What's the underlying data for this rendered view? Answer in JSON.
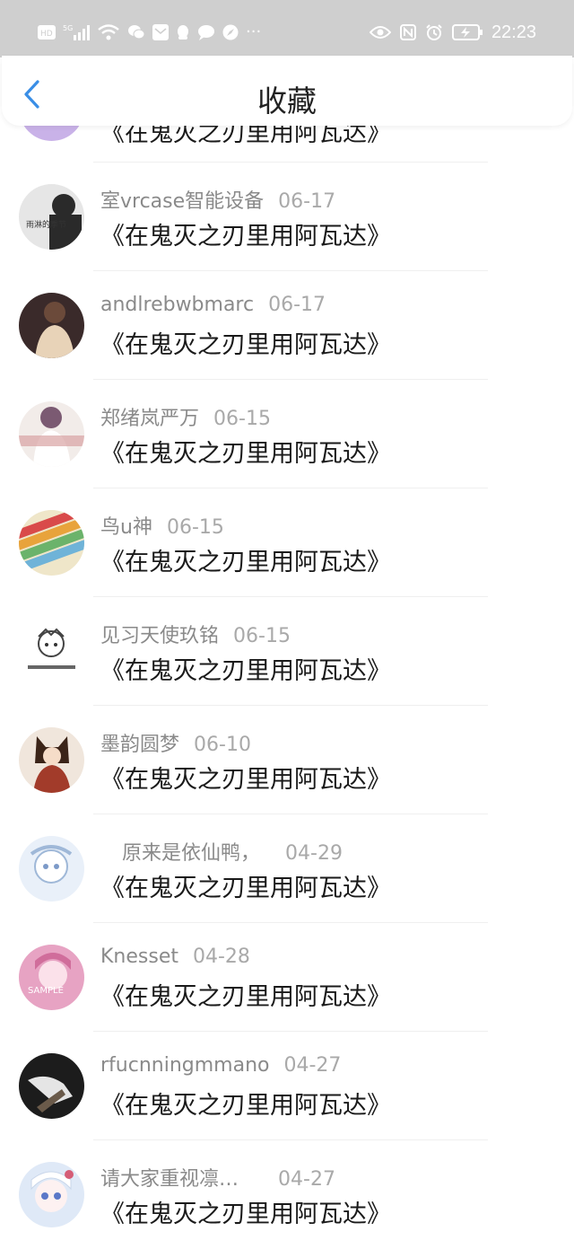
{
  "status_bar": {
    "time": "22:23",
    "icons": [
      "hd-icon",
      "signal-5g-icon",
      "wifi-icon",
      "wechat-icon",
      "mail-icon",
      "qq-icon",
      "chat-icon",
      "compass-icon",
      "more-icon",
      "eye-icon",
      "nfc-icon",
      "alarm-icon",
      "battery-charging-icon"
    ]
  },
  "header": {
    "title": "收藏",
    "back_icon": "chevron-left-icon"
  },
  "top_partial": {
    "text": "《在鬼灭之刃里用阿瓦达》",
    "avatar_color": "#c9b2e8"
  },
  "items": [
    {
      "name": "室vrcase智能设备",
      "date": "06-17",
      "text": "《在鬼灭之刃里用阿瓦达》",
      "avatar": {
        "bg": "#e6e6e6",
        "fg": "#2a2a2a"
      }
    },
    {
      "name": "andlrebwbmarc",
      "date": "06-17",
      "text": "《在鬼灭之刃里用阿瓦达》",
      "avatar": {
        "bg": "#3a2a2a",
        "fg": "#e8d3b8"
      }
    },
    {
      "name": "郑绪岚严万",
      "date": "06-15",
      "text": "《在鬼灭之刃里用阿瓦达》",
      "avatar": {
        "bg": "#f2ece9",
        "fg": "#a37d8f"
      }
    },
    {
      "name": "鸟u神",
      "date": "06-15",
      "text": "《在鬼灭之刃里用阿瓦达》",
      "avatar": {
        "bg": "#d96b4a",
        "fg": "#6fb3d8"
      }
    },
    {
      "name": "见习天使玖铭",
      "date": "06-15",
      "text": "《在鬼灭之刃里用阿瓦达》",
      "avatar": {
        "bg": "#ffffff",
        "fg": "#555555"
      }
    },
    {
      "name": "墨韵圆梦",
      "date": "06-10",
      "text": "《在鬼灭之刃里用阿瓦达》",
      "avatar": {
        "bg": "#f0e6dc",
        "fg": "#3b2418"
      }
    },
    {
      "name": "原来是依仙鸭，",
      "date": "04-29",
      "text": "《在鬼灭之刃里用阿瓦达》",
      "avatar": {
        "bg": "#e9f0f9",
        "fg": "#9fb8d8"
      }
    },
    {
      "name": "Knesset",
      "date": "04-28",
      "text": "《在鬼灭之刃里用阿瓦达》",
      "avatar": {
        "bg": "#e7a3c3",
        "fg": "#ffffff"
      }
    },
    {
      "name": "rfucnningmmano",
      "date": "04-27",
      "text": "《在鬼灭之刃里用阿瓦达》",
      "avatar": {
        "bg": "#1c1c1c",
        "fg": "#e5e5e5"
      }
    },
    {
      "name": "请大家重视凛…",
      "date": "04-27",
      "text": "《在鬼灭之刃里用阿瓦达》",
      "avatar": {
        "bg": "#dfe9f7",
        "fg": "#d55d76"
      }
    }
  ]
}
